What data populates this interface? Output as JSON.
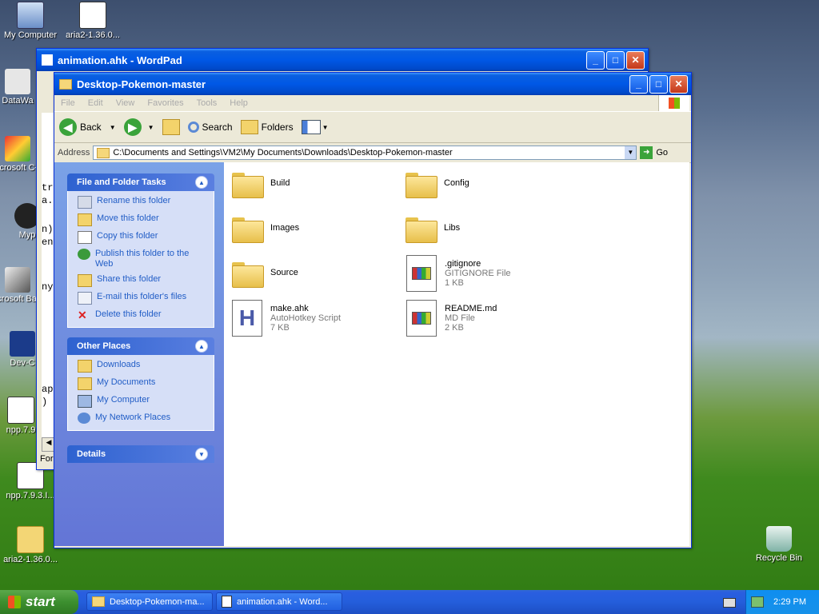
{
  "desktop": {
    "icons": [
      {
        "label": "My Computer"
      },
      {
        "label": "aria2-1.36.0..."
      },
      {
        "label": "DataWa"
      },
      {
        "label": "Microsoft C++"
      },
      {
        "label": "Myp"
      },
      {
        "label": "Microsoft Basic"
      },
      {
        "label": "Dev-C"
      },
      {
        "label": "npp.7.9"
      },
      {
        "label": "npp.7.9.3.I..."
      },
      {
        "label": "aria2-1.36.0..."
      },
      {
        "label": "Recycle Bin"
      }
    ]
  },
  "wordpad": {
    "title": "animation.ahk - WordPad",
    "partial_text": [
      "tr",
      "a.",
      "n)",
      "en",
      "ny",
      "app",
      ") *"
    ],
    "status": "For"
  },
  "explorer": {
    "title": "Desktop-Pokemon-master",
    "menu": [
      "File",
      "Edit",
      "View",
      "Favorites",
      "Tools",
      "Help"
    ],
    "toolbar": {
      "back": "Back",
      "search": "Search",
      "folders": "Folders"
    },
    "address": {
      "label": "Address",
      "value": "C:\\Documents and Settings\\VM2\\My Documents\\Downloads\\Desktop-Pokemon-master",
      "go": "Go"
    },
    "tasks": {
      "title": "File and Folder Tasks",
      "items": [
        "Rename this folder",
        "Move this folder",
        "Copy this folder",
        "Publish this folder to the Web",
        "Share this folder",
        "E-mail this folder's files",
        "Delete this folder"
      ]
    },
    "places": {
      "title": "Other Places",
      "items": [
        "Downloads",
        "My Documents",
        "My Computer",
        "My Network Places"
      ]
    },
    "details": {
      "title": "Details"
    },
    "files": [
      {
        "name": "Build",
        "kind": "folder"
      },
      {
        "name": "Config",
        "kind": "folder"
      },
      {
        "name": "Images",
        "kind": "folder"
      },
      {
        "name": "Libs",
        "kind": "folder"
      },
      {
        "name": "Source",
        "kind": "folder"
      },
      {
        "name": ".gitignore",
        "type": "GITIGNORE File",
        "size": "1 KB"
      },
      {
        "name": "make.ahk",
        "type": "AutoHotkey Script",
        "size": "7 KB"
      },
      {
        "name": "README.md",
        "type": "MD File",
        "size": "2 KB"
      }
    ]
  },
  "taskbar": {
    "start": "start",
    "buttons": [
      "Desktop-Pokemon-ma...",
      "animation.ahk - Word..."
    ],
    "clock": "2:29 PM"
  }
}
